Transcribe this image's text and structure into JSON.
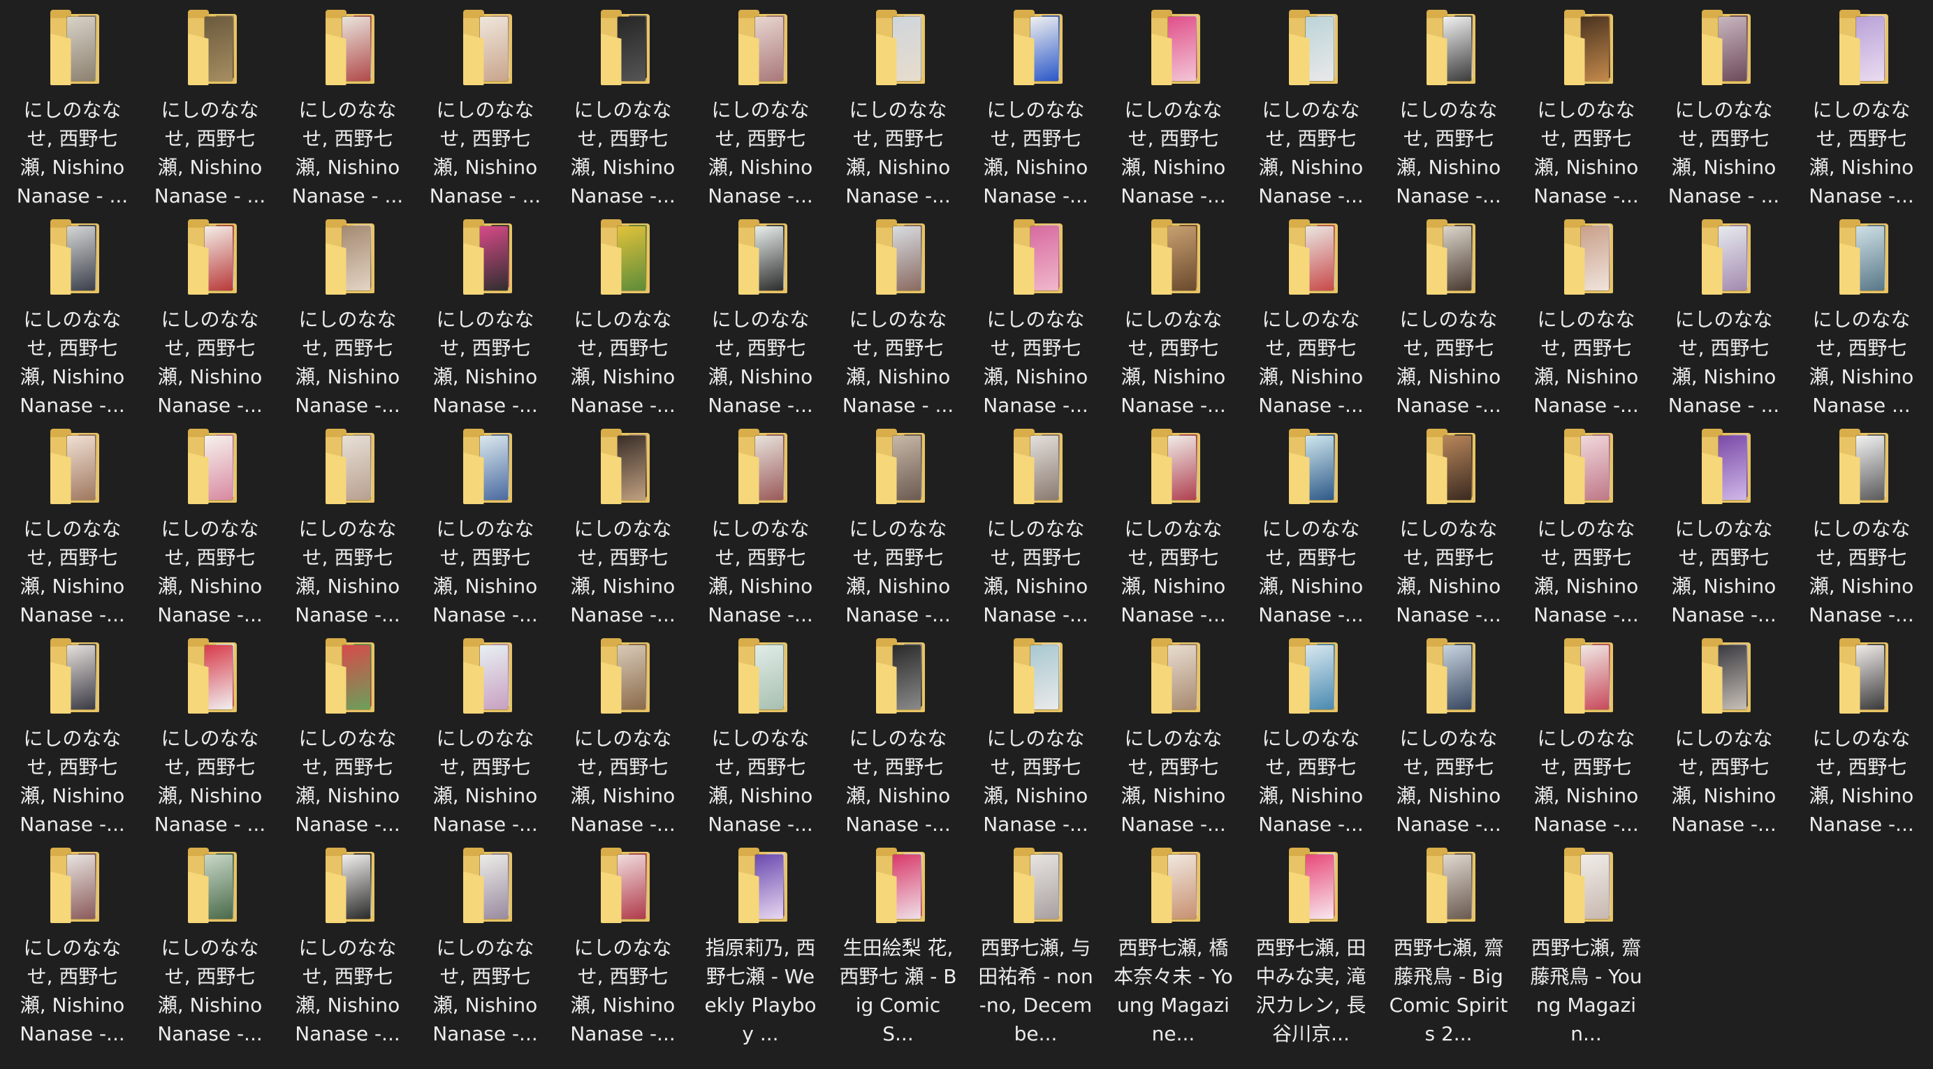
{
  "folders": [
    {
      "label": "にしのなな せ, 西野七 瀬, Nishino Nanase - ...",
      "tones": [
        "#d8d2c8",
        "#8c8170"
      ]
    },
    {
      "label": "にしのなな せ, 西野七 瀬, Nishino Nanase - ...",
      "tones": [
        "#6b5a3e",
        "#a68e62"
      ]
    },
    {
      "label": "にしのなな せ, 西野七 瀬, Nishino Nanase - ...",
      "tones": [
        "#e9e4dc",
        "#b04a4a"
      ]
    },
    {
      "label": "にしのなな せ, 西野七 瀬, Nishino Nanase - ...",
      "tones": [
        "#efe6dc",
        "#c9a58c"
      ]
    },
    {
      "label": "にしのなな せ, 西野七 瀬, Nishino Nanase -...",
      "tones": [
        "#262626",
        "#555555"
      ]
    },
    {
      "label": "にしのなな せ, 西野七 瀬, Nishino Nanase -...",
      "tones": [
        "#e8d6d0",
        "#a9787a"
      ]
    },
    {
      "label": "にしのなな せ, 西野七 瀬, Nishino Nanase -...",
      "tones": [
        "#cfd6dc",
        "#e8dccc"
      ]
    },
    {
      "label": "にしのなな せ, 西野七 瀬, Nishino Nanase -...",
      "tones": [
        "#f0f0f0",
        "#2a57c8"
      ]
    },
    {
      "label": "にしのなな せ, 西野七 瀬, Nishino Nanase -...",
      "tones": [
        "#e0508a",
        "#f3c6d6"
      ]
    },
    {
      "label": "にしのなな せ, 西野七 瀬, Nishino Nanase -...",
      "tones": [
        "#bcd4d8",
        "#e9e9e9"
      ]
    },
    {
      "label": "にしのなな せ, 西野七 瀬, Nishino Nanase -...",
      "tones": [
        "#f2f2f2",
        "#3b3b3b"
      ]
    },
    {
      "label": "にしのなな せ, 西野七 瀬, Nishino Nanase -...",
      "tones": [
        "#4a3320",
        "#c48a4c"
      ]
    },
    {
      "label": "にしのなな せ, 西野七 瀬, Nishino Nanase - ...",
      "tones": [
        "#c9b7c0",
        "#6d4a5a"
      ]
    },
    {
      "label": "にしのなな せ, 西野七 瀬, Nishino Nanase -...",
      "tones": [
        "#b9a2d8",
        "#eadcf0"
      ]
    },
    {
      "label": "にしのなな せ, 西野七 瀬, Nishino Nanase -...",
      "tones": [
        "#d6d6d6",
        "#3a3f4a"
      ]
    },
    {
      "label": "にしのなな せ, 西野七 瀬, Nishino Nanase -...",
      "tones": [
        "#f4eee8",
        "#b83a3a"
      ]
    },
    {
      "label": "にしのなな せ, 西野七 瀬, Nishino Nanase -...",
      "tones": [
        "#a58a72",
        "#e3d4c4"
      ]
    },
    {
      "label": "にしのなな せ, 西野七 瀬, Nishino Nanase -...",
      "tones": [
        "#d84a88",
        "#2e2e2e"
      ]
    },
    {
      "label": "にしのなな せ, 西野七 瀬, Nishino Nanase -...",
      "tones": [
        "#e2c23a",
        "#5c8c3a"
      ]
    },
    {
      "label": "にしのなな せ, 西野七 瀬, Nishino Nanase -...",
      "tones": [
        "#e8efec",
        "#2c2c2c"
      ]
    },
    {
      "label": "にしのなな せ, 西野七 瀬, Nishino Nanase - ...",
      "tones": [
        "#d8dde2",
        "#8a6a60"
      ]
    },
    {
      "label": "にしのなな せ, 西野七 瀬, Nishino Nanase -...",
      "tones": [
        "#d86aa0",
        "#f0b8cc"
      ]
    },
    {
      "label": "にしのなな せ, 西野七 瀬, Nishino Nanase -...",
      "tones": [
        "#c8a070",
        "#6a4a2e"
      ]
    },
    {
      "label": "にしのなな せ, 西野七 瀬, Nishino Nanase -...",
      "tones": [
        "#eae6e2",
        "#c84a4a"
      ]
    },
    {
      "label": "にしのなな せ, 西野七 瀬, Nishino Nanase -...",
      "tones": [
        "#dcd6cc",
        "#4a3a30"
      ]
    },
    {
      "label": "にしのなな せ, 西野七 瀬, Nishino Nanase -...",
      "tones": [
        "#c9a08a",
        "#f0e4dc"
      ]
    },
    {
      "label": "にしのなな せ, 西野七 瀬, Nishino Nanase - ...",
      "tones": [
        "#e6eaee",
        "#a48ab0"
      ]
    },
    {
      "label": "にしのなな せ, 西野七 瀬, Nishino Nanase ...",
      "tones": [
        "#cfe0e6",
        "#587888"
      ]
    },
    {
      "label": "にしのなな せ, 西野七 瀬, Nishino Nanase -...",
      "tones": [
        "#f0e0d4",
        "#a07860"
      ]
    },
    {
      "label": "にしのなな せ, 西野七 瀬, Nishino Nanase -...",
      "tones": [
        "#f6f2ee",
        "#d88aa0"
      ]
    },
    {
      "label": "にしのなな せ, 西野七 瀬, Nishino Nanase -...",
      "tones": [
        "#e8e0d6",
        "#b8a090"
      ]
    },
    {
      "label": "にしのなな せ, 西野七 瀬, Nishino Nanase -...",
      "tones": [
        "#dbe8ee",
        "#4a6aa0"
      ]
    },
    {
      "label": "にしのなな せ, 西野七 瀬, Nishino Nanase -...",
      "tones": [
        "#3a2e28",
        "#c0a080"
      ]
    },
    {
      "label": "にしのなな せ, 西野七 瀬, Nishino Nanase -...",
      "tones": [
        "#e8e2dc",
        "#9a5a5a"
      ]
    },
    {
      "label": "にしのなな せ, 西野七 瀬, Nishino Nanase -...",
      "tones": [
        "#c8b8a8",
        "#6a5a50"
      ]
    },
    {
      "label": "にしのなな せ, 西野七 瀬, Nishino Nanase -...",
      "tones": [
        "#e4e0dc",
        "#8a7a70"
      ]
    },
    {
      "label": "にしのなな せ, 西野七 瀬, Nishino Nanase -...",
      "tones": [
        "#f0ece8",
        "#b04050"
      ]
    },
    {
      "label": "にしのなな せ, 西野七 瀬, Nishino Nanase -...",
      "tones": [
        "#cfe6ee",
        "#2e5a88"
      ]
    },
    {
      "label": "にしのなな せ, 西野七 瀬, Nishino Nanase -...",
      "tones": [
        "#b8865a",
        "#3a2a20"
      ]
    },
    {
      "label": "にしのなな せ, 西野七 瀬, Nishino Nanase -...",
      "tones": [
        "#f0d8dc",
        "#c07888"
      ]
    },
    {
      "label": "にしのなな せ, 西野七 瀬, Nishino Nanase -...",
      "tones": [
        "#7a4aa8",
        "#d0b8e8"
      ]
    },
    {
      "label": "にしのなな せ, 西野七 瀬, Nishino Nanase -...",
      "tones": [
        "#f2f2f2",
        "#5a5a5a"
      ]
    },
    {
      "label": "にしのなな せ, 西野七 瀬, Nishino Nanase -...",
      "tones": [
        "#e6e0dc",
        "#3a3a44"
      ]
    },
    {
      "label": "にしのなな せ, 西野七 瀬, Nishino Nanase - ...",
      "tones": [
        "#d83a4a",
        "#f0f0f0"
      ]
    },
    {
      "label": "にしのなな せ, 西野七 瀬, Nishino Nanase -...",
      "tones": [
        "#d84a4a",
        "#6aa05a"
      ]
    },
    {
      "label": "にしのなな せ, 西野七 瀬, Nishino Nanase -...",
      "tones": [
        "#e8f0f4",
        "#c8a0c0"
      ]
    },
    {
      "label": "にしのなな せ, 西野七 瀬, Nishino Nanase -...",
      "tones": [
        "#d8cab8",
        "#8a6a4a"
      ]
    },
    {
      "label": "にしのなな せ, 西野七 瀬, Nishino Nanase -...",
      "tones": [
        "#e0ece8",
        "#a8c0b0"
      ]
    },
    {
      "label": "にしのなな せ, 西野七 瀬, Nishino Nanase -...",
      "tones": [
        "#2a2a2a",
        "#8a8a8a"
      ]
    },
    {
      "label": "にしのなな せ, 西野七 瀬, Nishino Nanase -...",
      "tones": [
        "#a8c8d0",
        "#eaeaea"
      ]
    },
    {
      "label": "にしのなな せ, 西野七 瀬, Nishino Nanase -...",
      "tones": [
        "#e8dcd0",
        "#a88a70"
      ]
    },
    {
      "label": "にしのなな せ, 西野七 瀬, Nishino Nanase -...",
      "tones": [
        "#d8e8f0",
        "#4a8ab0"
      ]
    },
    {
      "label": "にしのなな せ, 西野七 瀬, Nishino Nanase -...",
      "tones": [
        "#c8d4e0",
        "#384860"
      ]
    },
    {
      "label": "にしのなな せ, 西野七 瀬, Nishino Nanase -...",
      "tones": [
        "#f0e8e4",
        "#c84a5a"
      ]
    },
    {
      "label": "にしのなな せ, 西野七 瀬, Nishino Nanase -...",
      "tones": [
        "#3a3a40",
        "#c8c0b8"
      ]
    },
    {
      "label": "にしのなな せ, 西野七 瀬, Nishino Nanase -...",
      "tones": [
        "#f0ecea",
        "#3a3a3a"
      ]
    },
    {
      "label": "にしのなな せ, 西野七 瀬, Nishino Nanase -...",
      "tones": [
        "#e8e4e0",
        "#8a5a5a"
      ]
    },
    {
      "label": "にしのなな せ, 西野七 瀬, Nishino Nanase -...",
      "tones": [
        "#c8d8c8",
        "#4a6a4a"
      ]
    },
    {
      "label": "にしのなな せ, 西野七 瀬, Nishino Nanase -...",
      "tones": [
        "#f2f0ee",
        "#2a2a2a"
      ]
    },
    {
      "label": "にしのなな せ, 西野七 瀬, Nishino Nanase -...",
      "tones": [
        "#ecece8",
        "#9a8aa0"
      ]
    },
    {
      "label": "にしのなな せ, 西野七 瀬, Nishino Nanase -...",
      "tones": [
        "#f0dcdc",
        "#b03a4a"
      ]
    },
    {
      "label": "指原莉乃, 西野七瀬 - Weekly Playboy ...",
      "tones": [
        "#6a4ab0",
        "#e8d8f0"
      ]
    },
    {
      "label": "生田絵梨 花, 西野七 瀬 - Big Comic S...",
      "tones": [
        "#d83a6a",
        "#f0e0e8"
      ]
    },
    {
      "label": "西野七瀬, 与田祐希 - non-no, Decembe...",
      "tones": [
        "#e8e4e0",
        "#a8a0a0"
      ]
    },
    {
      "label": "西野七瀬, 橋本奈々未 - Young Magazine...",
      "tones": [
        "#f0e8e0",
        "#c89070"
      ]
    },
    {
      "label": "西野七瀬, 田中みな実, 滝沢カレン, 長谷川京...",
      "tones": [
        "#e84a7a",
        "#f8e8ee"
      ]
    },
    {
      "label": "西野七瀬, 齋藤飛鳥 - Big Comic Spirits 2...",
      "tones": [
        "#e0d8d0",
        "#6a5a50"
      ]
    },
    {
      "label": "西野七瀬, 齋藤飛鳥 - Young Magazin...",
      "tones": [
        "#f0ece8",
        "#c8b8b0"
      ]
    }
  ]
}
